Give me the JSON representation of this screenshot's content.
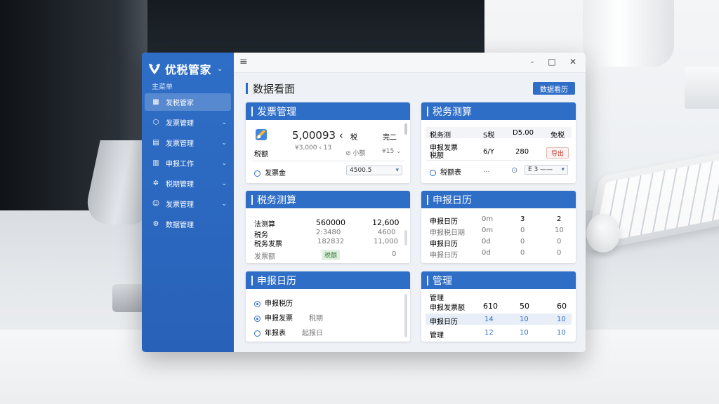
{
  "app": {
    "name": "优税管家",
    "section_label": "主菜单"
  },
  "sidebar": {
    "items": [
      {
        "label": "发税管家",
        "icon": "grid-icon",
        "active": true
      },
      {
        "label": "发票管理",
        "icon": "cube-icon",
        "caret": "⌄"
      },
      {
        "label": "发票管理",
        "icon": "document-icon",
        "caret": "⌄"
      },
      {
        "label": "申报工作",
        "icon": "table-icon",
        "caret": "⌄"
      },
      {
        "label": "税期管理",
        "icon": "gear-icon",
        "caret": "⌄"
      },
      {
        "label": "发票管理",
        "icon": "people-icon",
        "caret": "⌄"
      },
      {
        "label": "数据管理",
        "icon": "settings-icon"
      }
    ]
  },
  "titlebar": {
    "menu": "≡",
    "minimize": "-",
    "maximize": "□",
    "close": "✕"
  },
  "page": {
    "title": "数据看面",
    "top_button": "数据看历"
  },
  "cards": {
    "invoice": {
      "title": "发票管理",
      "amount": "5,00093 ‹",
      "col2": "税",
      "col3": "完二",
      "label2": "税额",
      "sub_amount": "¥3,000 ‹ 13",
      "sub_mid": "⊘ 小额",
      "sub_right": "¥15 ⌄",
      "footer_label": "发票金",
      "footer_select": "4500.5",
      "footer_arrow": "▾"
    },
    "tax_calc_top": {
      "title": "税务测算",
      "rows": [
        {
          "a": "税务测",
          "b": "S税",
          "c": "D5.00",
          "d": "免税"
        },
        {
          "a": "申报发票\n税额",
          "b": "6/Y",
          "c": "280",
          "d": "导出"
        },
        {
          "a": "税额表",
          "b": "...",
          "c": "⊙",
          "d": "E 3 ——"
        }
      ]
    },
    "tax_calc": {
      "title": "税务测算",
      "rows": [
        {
          "a": "法测算",
          "b": "560000",
          "c": "12,600"
        },
        {
          "a": "税务",
          "b": "2:3480",
          "c": "4600"
        },
        {
          "a": "税务发票",
          "b": "182832",
          "c": "11,000"
        },
        {
          "a": "发票额",
          "b": "税额",
          "c": "0"
        }
      ]
    },
    "calendar_top": {
      "title": "申报日历",
      "rows": [
        {
          "a": "申报日历",
          "b": "0m",
          "c": "3",
          "d": "2"
        },
        {
          "a": "申报税日期",
          "b": "0m",
          "c": "0",
          "d": "10"
        },
        {
          "a": "申报日历",
          "b": "0d",
          "c": "0",
          "d": "0"
        },
        {
          "a": "申报日历",
          "b": "0d",
          "c": "0",
          "d": "0"
        }
      ]
    },
    "calendar": {
      "title": "申报日历",
      "items": [
        {
          "label": "申报税历"
        },
        {
          "label": "申报发票",
          "value": "税期"
        },
        {
          "label": "年报表",
          "value": "起报日"
        }
      ]
    },
    "manage": {
      "title": "管理",
      "header_row": {
        "a": "管理"
      },
      "rows": [
        {
          "a": "申报发票额",
          "b": "610",
          "c": "50",
          "d": "60"
        },
        {
          "a": "申报日历",
          "b": "14",
          "c": "10",
          "d": "10"
        },
        {
          "a": "管理",
          "b": "12",
          "c": "10",
          "d": "10"
        }
      ]
    }
  },
  "colors": {
    "accent": "#2f6ec7",
    "sidebar": "#2862b8"
  }
}
